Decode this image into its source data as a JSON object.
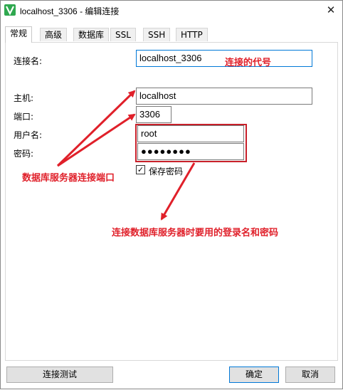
{
  "window": {
    "title": "localhost_3306 - 编辑连接",
    "close_glyph": "✕",
    "icon": "navicat-leaf-icon"
  },
  "tabs": [
    {
      "label": "常规",
      "active": true
    },
    {
      "label": "高级",
      "active": false
    },
    {
      "label": "数据库",
      "active": false
    },
    {
      "label": "SSL",
      "active": false
    },
    {
      "label": "SSH",
      "active": false
    },
    {
      "label": "HTTP",
      "active": false
    }
  ],
  "form": {
    "connection_name_label": "连接名:",
    "connection_name_value": "localhost_3306",
    "host_label": "主机:",
    "host_value": "localhost",
    "port_label": "端口:",
    "port_value": "3306",
    "user_label": "用户名:",
    "user_value": "root",
    "password_label": "密码:",
    "password_value": "●●●●●●●●",
    "save_password_label": "保存密码",
    "save_password_checked": true,
    "check_glyph": "✓"
  },
  "annotations": {
    "connection_name_note": "连接的代号",
    "port_note": "数据库服务器连接端口",
    "credentials_note": "连接数据库服务器时要用的登录名和密码",
    "color": "#e0202a"
  },
  "buttons": {
    "test_connection": "连接测试",
    "ok": "确定",
    "cancel": "取消"
  }
}
